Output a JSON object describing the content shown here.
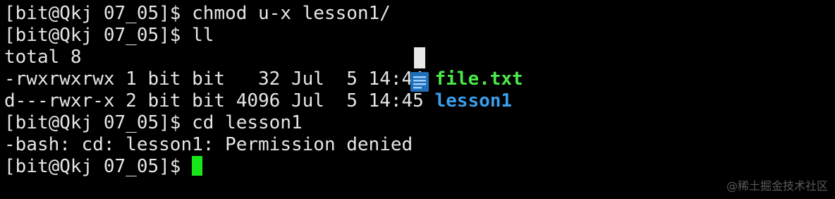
{
  "terminal": {
    "lines": [
      {
        "prompt": "[bit@Qkj 07_05]$ ",
        "command": "chmod u-x lesson1/"
      },
      {
        "prompt": "[bit@Qkj 07_05]$ ",
        "command": "ll"
      },
      {
        "text": "total 8"
      },
      {
        "meta": "-rwxrwxrwx 1 bit bit   32 Jul  5 14:44 ",
        "name": "file.txt",
        "kind": "file"
      },
      {
        "meta": "d---rwxr-x 2 bit bit 4096 Jul  5 14:45 ",
        "name": "lesson1",
        "kind": "directory"
      },
      {
        "prompt": "[bit@Qkj 07_05]$ ",
        "command": "cd lesson1"
      },
      {
        "text": "-bash: cd: lesson1: Permission denied"
      },
      {
        "prompt": "[bit@Qkj 07_05]$ ",
        "command": ""
      }
    ]
  },
  "icons": {
    "overlay": "document-icon"
  },
  "colors": {
    "background": "#000000",
    "text": "#e6e6e6",
    "file": "#4be84b",
    "directory": "#3b9eea",
    "cursor": "#19e619"
  },
  "watermark": "@稀土掘金技术社区"
}
